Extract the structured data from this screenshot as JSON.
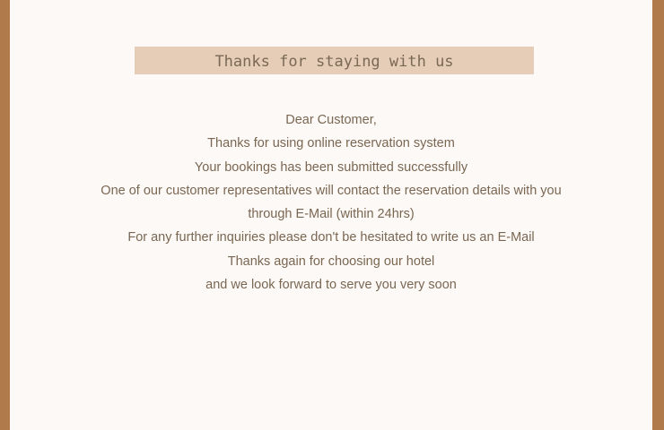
{
  "banner": {
    "title": "Thanks for staying with us"
  },
  "message": {
    "lines": [
      "Dear Customer,",
      "Thanks for using online reservation system",
      "Your bookings has been submitted successfully",
      "One of our customer representatives will contact the reservation details with you",
      "through E-Mail (within 24hrs)",
      "For any further inquiries please don't be hesitated to write us an E-Mail",
      "Thanks again for choosing our hotel",
      "and we look forward to serve you very soon"
    ]
  },
  "colors": {
    "outer_frame": "#b07a4a",
    "panel_background": "#fdf9f7",
    "banner_background": "#e6cdb8",
    "text": "#7a6752"
  }
}
